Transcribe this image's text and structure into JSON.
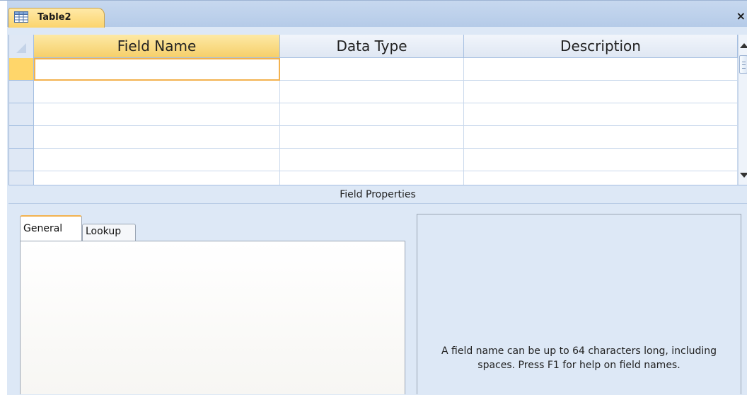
{
  "document": {
    "tab_title": "Table2",
    "close_glyph": "×"
  },
  "grid": {
    "columns": [
      {
        "label": "Field Name"
      },
      {
        "label": "Data Type"
      },
      {
        "label": "Description"
      }
    ],
    "rows": [
      [
        "",
        "",
        ""
      ],
      [
        "",
        "",
        ""
      ],
      [
        "",
        "",
        ""
      ],
      [
        "",
        "",
        ""
      ],
      [
        "",
        "",
        ""
      ]
    ]
  },
  "field_properties": {
    "title": "Field Properties",
    "tabs": [
      {
        "label": "General",
        "selected": true
      },
      {
        "label": "Lookup",
        "selected": false
      }
    ],
    "help_text": "A field name can be up to 64 characters long, including spaces. Press F1 for help on field names."
  },
  "colors": {
    "accent": "#f3b24f",
    "header_active": "#f6cf6a",
    "chrome": "#dde8f6"
  }
}
